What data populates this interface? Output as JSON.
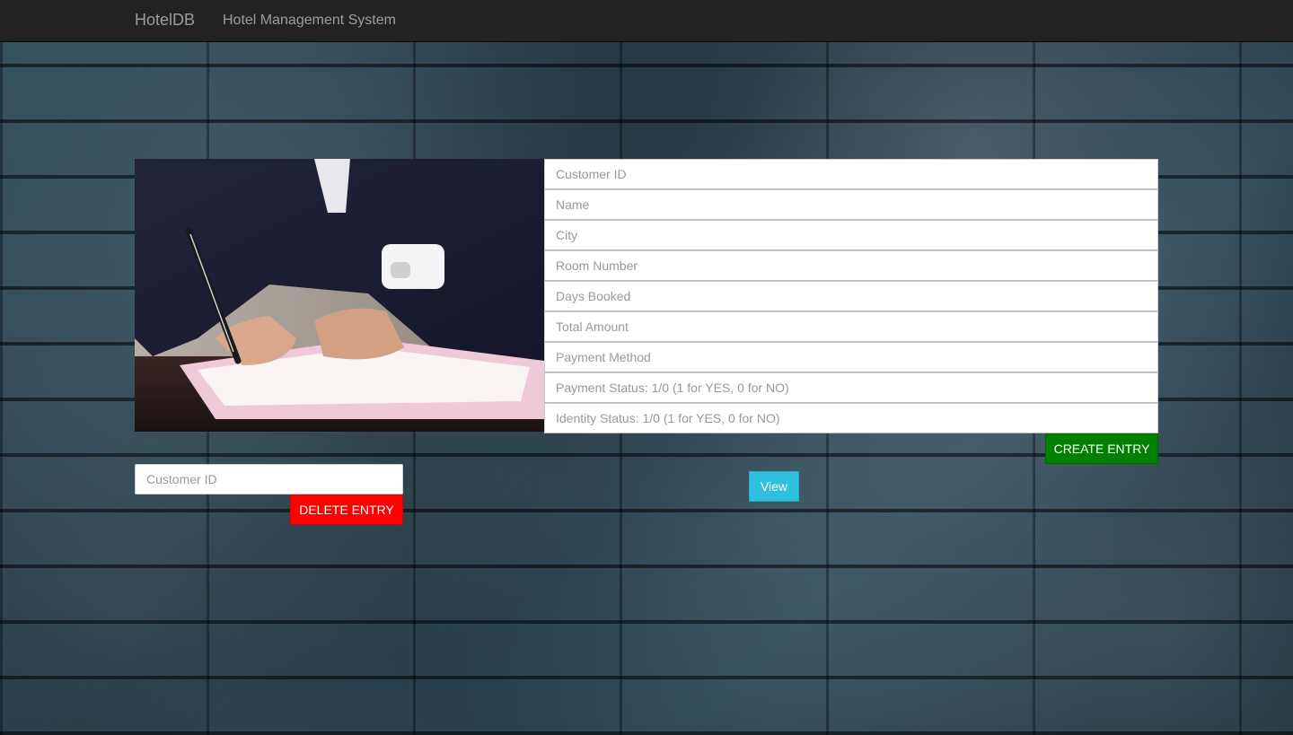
{
  "navbar": {
    "brand": "HotelDB",
    "link": "Hotel Management System"
  },
  "create_form": {
    "fields": [
      {
        "placeholder": "Customer ID"
      },
      {
        "placeholder": "Name"
      },
      {
        "placeholder": "City"
      },
      {
        "placeholder": "Room Number"
      },
      {
        "placeholder": "Days Booked"
      },
      {
        "placeholder": "Total Amount"
      },
      {
        "placeholder": "Payment Method"
      },
      {
        "placeholder": "Payment Status: 1/0 (1 for YES, 0 for NO)"
      },
      {
        "placeholder": "Identity Status: 1/0 (1 for YES, 0 for NO)"
      }
    ],
    "submit_label": "CREATE ENTRY"
  },
  "delete_form": {
    "placeholder": "Customer ID",
    "submit_label": "DELETE ENTRY"
  },
  "view_button": {
    "label": "View"
  },
  "colors": {
    "navbar_bg": "#222222",
    "create_button": "#008000",
    "delete_button": "#ff0000",
    "view_button": "#2fbfe0"
  }
}
